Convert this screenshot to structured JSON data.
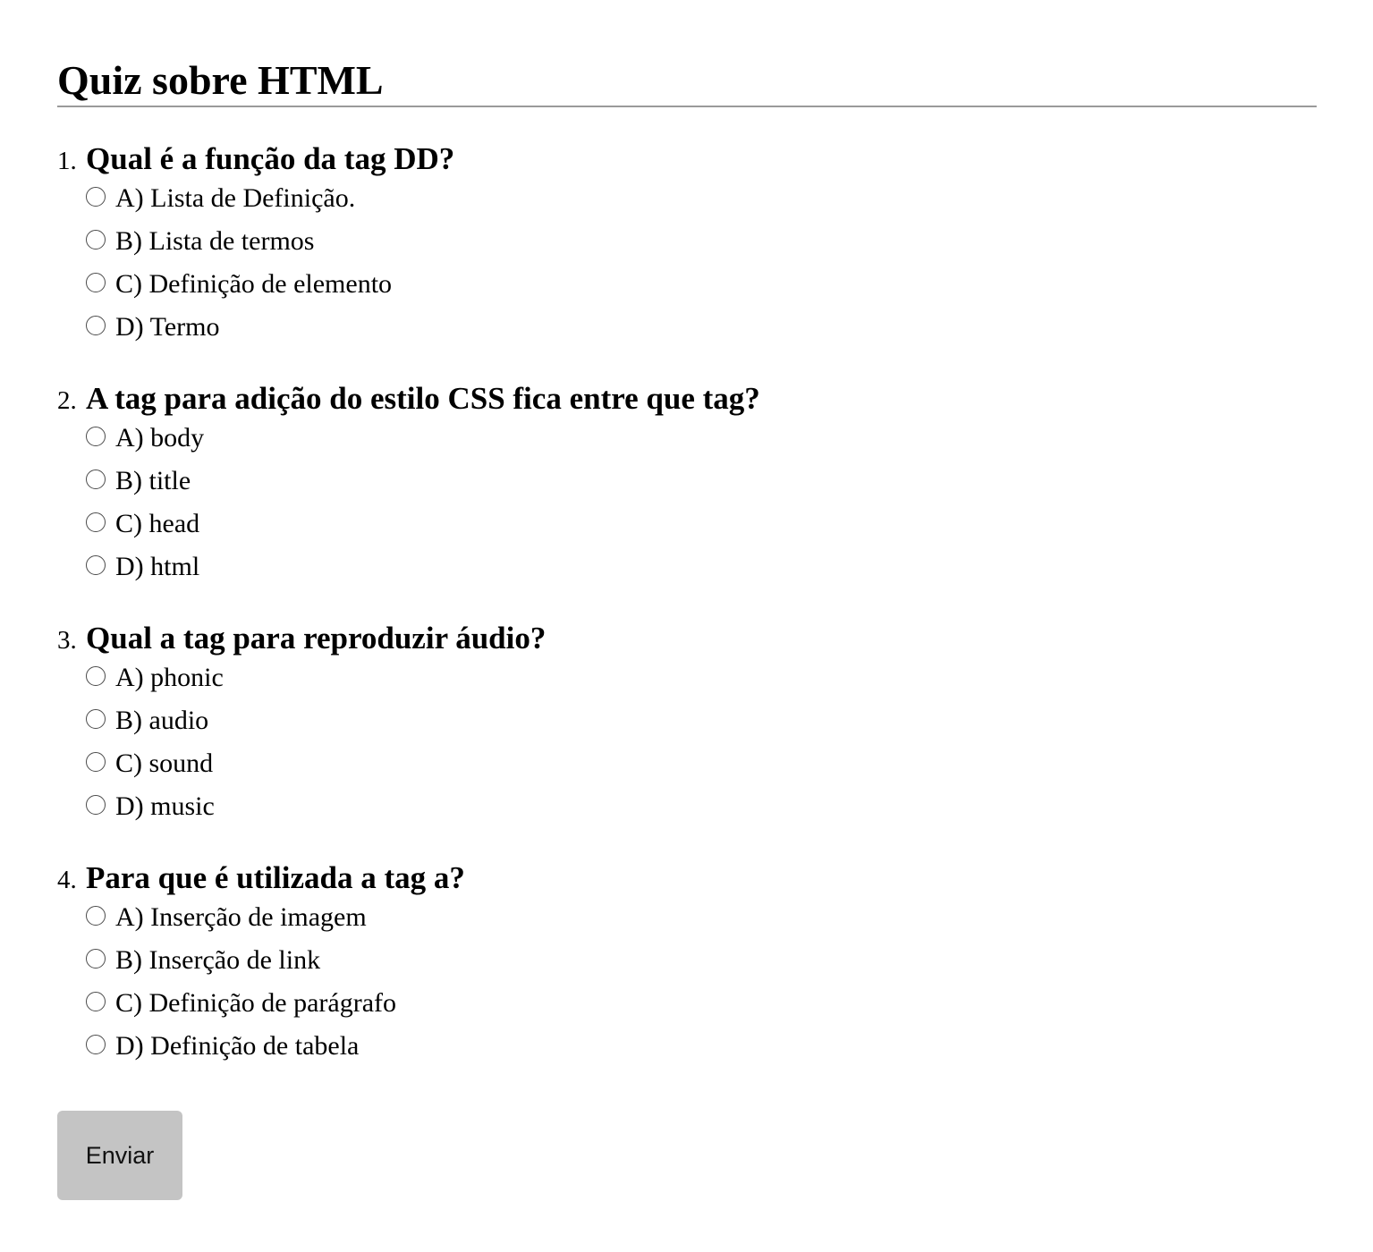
{
  "page": {
    "title": "Quiz sobre HTML",
    "submit_label": "Enviar"
  },
  "questions": [
    {
      "number": "1.",
      "text": "Qual é a função da tag DD?",
      "options": [
        "A) Lista de Definição.",
        "B) Lista de termos",
        "C) Definição de elemento",
        "D) Termo"
      ]
    },
    {
      "number": "2.",
      "text": "A tag para adição do estilo CSS fica entre que tag?",
      "options": [
        "A) body",
        "B) title",
        "C) head",
        "D) html"
      ]
    },
    {
      "number": "3.",
      "text": "Qual a tag para reproduzir áudio?",
      "options": [
        "A) phonic",
        "B) audio",
        "C) sound",
        "D) music"
      ]
    },
    {
      "number": "4.",
      "text": "Para que é utilizada a tag a?",
      "options": [
        "A) Inserção de imagem",
        "B) Inserção de link",
        "C) Definição de parágrafo",
        "D) Definição de tabela"
      ]
    }
  ]
}
